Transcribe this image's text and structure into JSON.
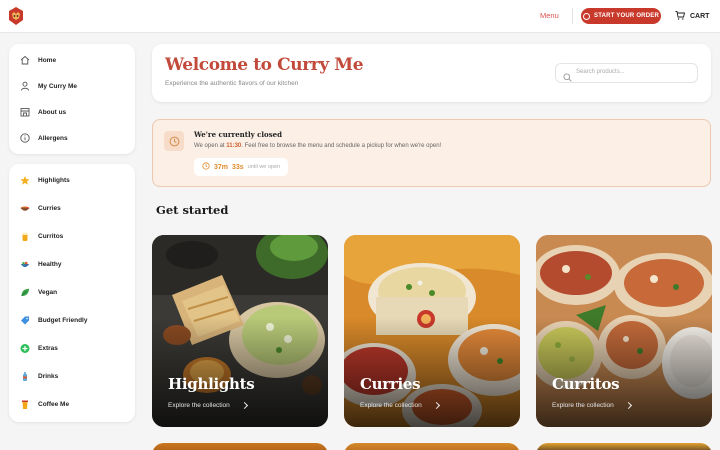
{
  "header": {
    "menu_label": "Menu",
    "start_order_label": "START YOUR ORDER",
    "cart_label": "CART"
  },
  "sidebar": {
    "main_items": [
      {
        "label": "Home",
        "icon": "home-icon"
      },
      {
        "label": "My Curry Me",
        "icon": "user-icon"
      },
      {
        "label": "About us",
        "icon": "store-icon"
      },
      {
        "label": "Allergens",
        "icon": "info-icon"
      }
    ],
    "category_items": [
      {
        "label": "Highlights",
        "icon": "star-icon"
      },
      {
        "label": "Curries",
        "icon": "curry-bowl-icon"
      },
      {
        "label": "Curritos",
        "icon": "currito-icon"
      },
      {
        "label": "Healthy",
        "icon": "healthy-bowl-icon"
      },
      {
        "label": "Vegan",
        "icon": "leaf-icon"
      },
      {
        "label": "Budget Friendly",
        "icon": "tag-icon"
      },
      {
        "label": "Extras",
        "icon": "plus-icon"
      },
      {
        "label": "Drinks",
        "icon": "bottle-icon"
      },
      {
        "label": "Coffee Me",
        "icon": "coffee-cup-icon"
      }
    ]
  },
  "welcome": {
    "title": "Welcome to Curry Me",
    "subtitle": "Experience the authentic flavors of our kitchen",
    "search_placeholder": "Search products..."
  },
  "status": {
    "title": "We're currently closed",
    "message_prefix": "We open at ",
    "open_time": "11:30",
    "message_suffix": ". Feel free to browse the menu and schedule a pickup for when we're open!",
    "countdown_minutes": "37m",
    "countdown_seconds": "33s",
    "countdown_suffix": "until we open"
  },
  "get_started": {
    "heading": "Get started",
    "cards": [
      {
        "title": "Highlights",
        "link": "Explore the collection"
      },
      {
        "title": "Curries",
        "link": "Explore the collection"
      },
      {
        "title": "Curritos",
        "link": "Explore the collection"
      }
    ]
  },
  "colors": {
    "brand_red": "#c8392b",
    "title_red": "#c24a3b",
    "accent_orange": "#e08a2c",
    "closed_bg": "#fbefe6"
  }
}
